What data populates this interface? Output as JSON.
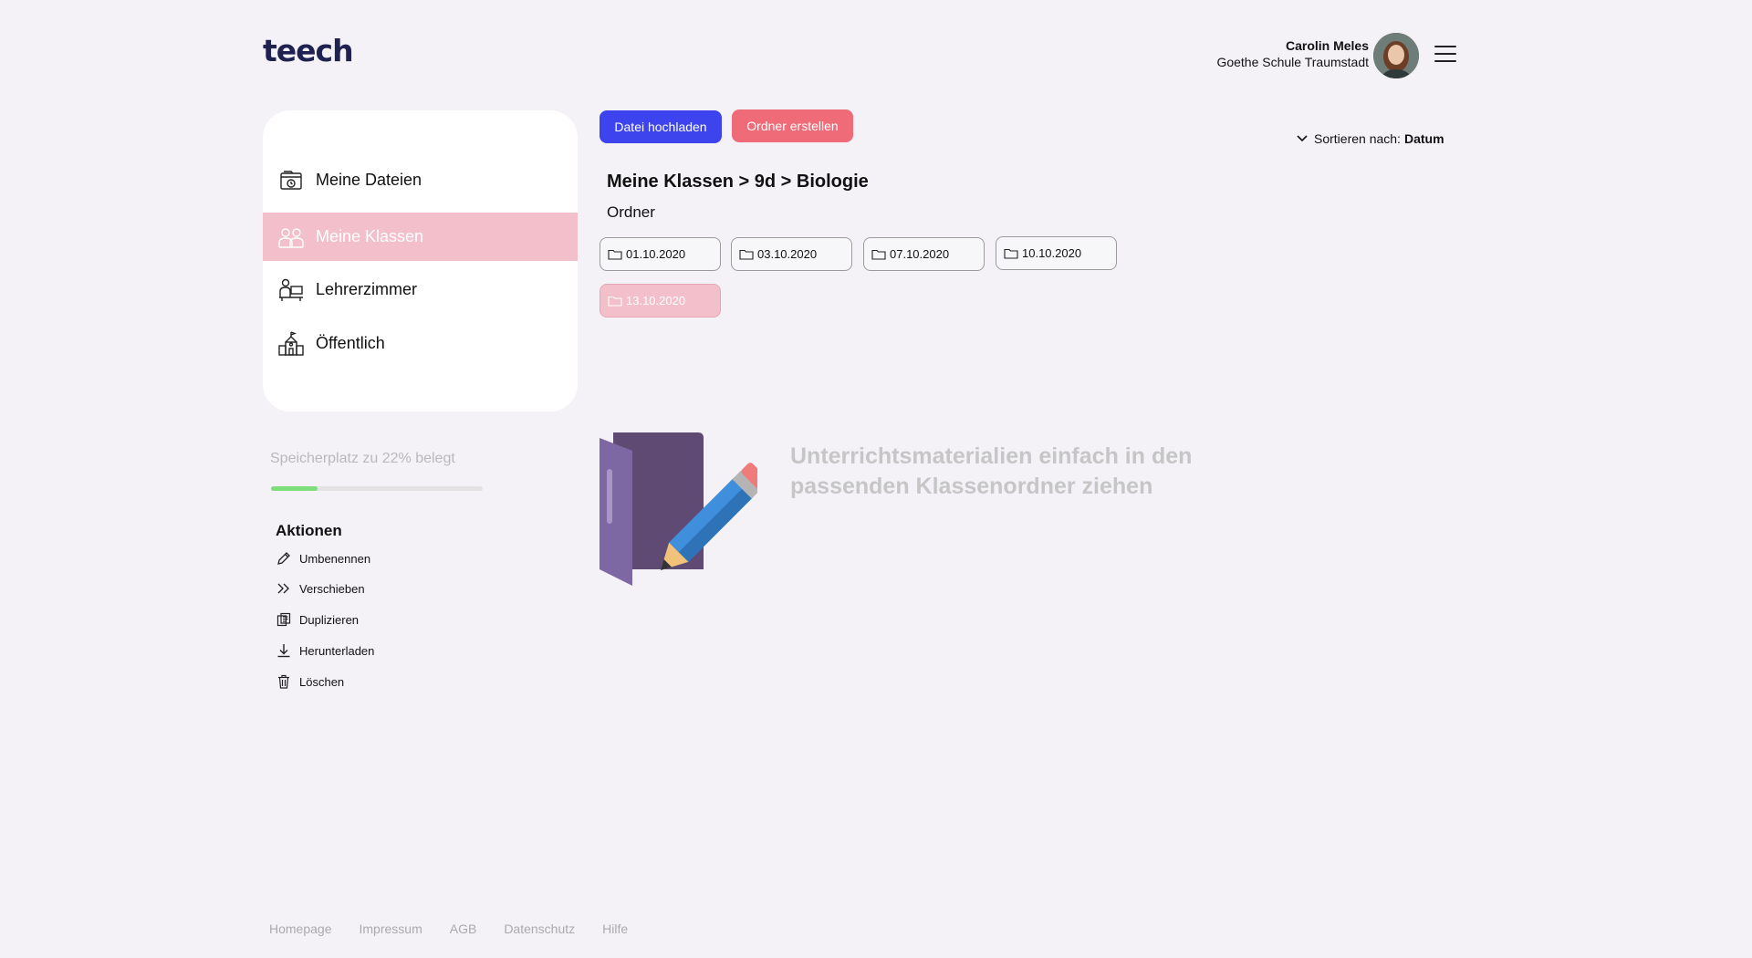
{
  "brand": {
    "logo": "teech"
  },
  "user": {
    "name": "Carolin Meles",
    "school": "Goethe Schule Traumstadt"
  },
  "sidebar": {
    "items": [
      {
        "label": "Meine Dateien",
        "icon": "folder-clock-icon",
        "active": false
      },
      {
        "label": "Meine Klassen",
        "icon": "class-people-icon",
        "active": true
      },
      {
        "label": "Lehrerzimmer",
        "icon": "teacher-desk-icon",
        "active": false
      },
      {
        "label": "Öffentlich",
        "icon": "school-building-icon",
        "active": false
      }
    ]
  },
  "storage": {
    "label": "Speicherplatz zu 22% belegt",
    "percent": 22
  },
  "actions": {
    "title": "Aktionen",
    "items": [
      {
        "label": "Umbenennen",
        "icon": "pencil-icon"
      },
      {
        "label": "Verschieben",
        "icon": "double-chevron-right-icon"
      },
      {
        "label": "Duplizieren",
        "icon": "duplicate-icon"
      },
      {
        "label": "Herunterladen",
        "icon": "download-icon"
      },
      {
        "label": "Löschen",
        "icon": "trash-icon"
      }
    ]
  },
  "toolbar": {
    "upload_label": "Datei hochladen",
    "create_folder_label": "Ordner erstellen"
  },
  "sort": {
    "label": "Sortieren nach:",
    "value": "Datum"
  },
  "breadcrumb": "Meine Klassen > 9d > Biologie",
  "section_label": "Ordner",
  "folders": [
    {
      "label": "01.10.2020",
      "active": false
    },
    {
      "label": "03.10.2020",
      "active": false
    },
    {
      "label": "07.10.2020",
      "active": false
    },
    {
      "label": "10.10.2020",
      "active": false
    },
    {
      "label": "13.10.2020",
      "active": true
    }
  ],
  "empty_hint": {
    "line1": "Unterrichtsmaterialien einfach in den",
    "line2": "passenden Klassenordner ziehen"
  },
  "footer": {
    "links": [
      "Homepage",
      "Impressum",
      "AGB",
      "Datenschutz",
      "Hilfe"
    ]
  },
  "colors": {
    "background": "#f4f2f7",
    "primary_button": "#3d44ee",
    "secondary_button": "#ef6b78",
    "active_nav": "#f2bfcb",
    "storage_fill": "#7ede7b",
    "logo": "#1f2250"
  }
}
